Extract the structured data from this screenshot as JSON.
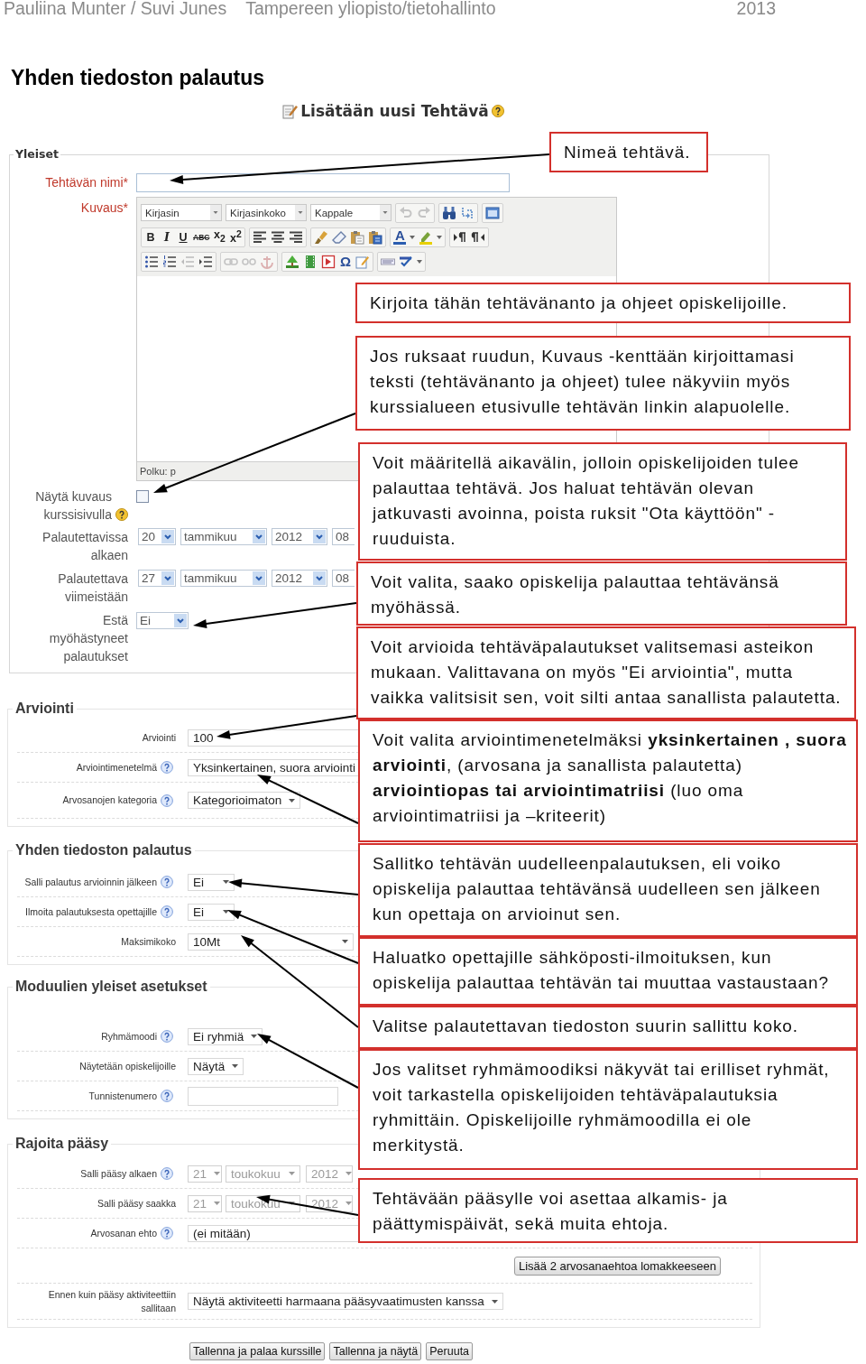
{
  "header": {
    "authors": "Pauliina Munter / Suvi Junes",
    "organization": "Tampereen yliopisto/tietohallinto",
    "year": "2013"
  },
  "heading": "Yhden tiedoston palautus",
  "form": {
    "title": "Lisätään uusi Tehtävä",
    "general": {
      "legend": "Yleiset",
      "rows": [
        {
          "kind": "text-input",
          "label": "Tehtävän nimi*",
          "required": true,
          "help": false
        },
        {
          "kind": "editor",
          "label": "Kuvaus*",
          "required": true,
          "help": false,
          "selects": [
            "Kirjasin",
            "Kirjasinkoko",
            "Kappale"
          ],
          "buttons": [
            "B",
            "I",
            "U",
            "ABC",
            "x$_{2}$",
            "x$^{2}$",
            "A",
            "Ω"
          ],
          "path": "Polku: p"
        },
        {
          "kind": "checkbox",
          "label": "Näytä kuvaus kurssisivulla",
          "required": false,
          "help": true,
          "checked": false
        },
        {
          "kind": "date",
          "label": "Palautettavissa alkaen",
          "required": false,
          "help": false,
          "parts": [
            "20",
            "tammikuu",
            "2012",
            "08"
          ]
        },
        {
          "kind": "date",
          "label": "Palautettava viimeistään",
          "required": false,
          "help": false,
          "parts": [
            "27",
            "tammikuu",
            "2012",
            "08"
          ]
        },
        {
          "kind": "select",
          "label": "Estä myöhästyneet palautukset",
          "required": false,
          "help": false,
          "value": "Ei"
        }
      ]
    },
    "sections": [
      {
        "legend": "Arviointi",
        "rows": [
          {
            "kind": "long-field",
            "label": "Arviointi",
            "help": false,
            "value": "100"
          },
          {
            "kind": "long-field",
            "label": "Arviointimenetelmä",
            "help": true,
            "value": "Yksinkertainen, suora arviointi"
          },
          {
            "kind": "select",
            "label": "Arvosanojen kategoria",
            "help": true,
            "value": "Kategorioimaton"
          }
        ]
      },
      {
        "legend": "Yhden tiedoston palautus",
        "rows": [
          {
            "kind": "select",
            "label": "Salli palautus arvioinnin jälkeen",
            "help": true,
            "value": "Ei"
          },
          {
            "kind": "select",
            "label": "Ilmoita palautuksesta opettajille",
            "help": true,
            "value": "Ei"
          },
          {
            "kind": "long-select",
            "label": "Maksimikoko",
            "help": false,
            "value": "10Mt"
          }
        ]
      },
      {
        "legend": "Moduulien yleiset asetukset",
        "rows": [
          {
            "kind": "select",
            "label": "Ryhmämoodi",
            "help": true,
            "value": "Ei ryhmiä"
          },
          {
            "kind": "select",
            "label": "Näytetään opiskelijoille",
            "help": false,
            "value": "Näytä"
          },
          {
            "kind": "input",
            "label": "Tunnistenumero",
            "help": true
          }
        ]
      },
      {
        "legend": "Rajoita pääsy",
        "rows": [
          {
            "kind": "date",
            "label": "Salli pääsy alkaen",
            "help": true,
            "disabled": true,
            "parts": [
              "21",
              "toukokuu",
              "2012"
            ]
          },
          {
            "kind": "date",
            "label": "Salli pääsy saakka",
            "help": false,
            "disabled": true,
            "parts": [
              "21",
              "toukokuu",
              "2012"
            ]
          },
          {
            "kind": "long-field",
            "label": "Arvosanan ehto",
            "help": true,
            "disabled": false,
            "value": "(ei mitään)"
          },
          {
            "kind": "button",
            "disabled": false,
            "value": "Lisää 2 arvosanaehtoa lomakkeeseen"
          },
          {
            "kind": "select",
            "label": "Ennen kuin pääsy aktiviteettiin sallitaan",
            "help": false,
            "disabled": false,
            "value": "Näytä aktiviteetti harmaana pääsyvaatimusten kanssa"
          }
        ]
      }
    ],
    "buttons": [
      "Tallenna ja palaa kurssille",
      "Tallenna ja näytä",
      "Peruuta"
    ]
  },
  "callouts": [
    {
      "text": "Nimeä tehtävä.",
      "arrow": true
    },
    {
      "text": "Kirjoita tähän tehtävänanto ja ohjeet opiskelijoille.",
      "arrow": false
    },
    {
      "text": "Jos ruksaat ruudun, Kuvaus -kenttään kirjoittamasi teksti (tehtävänanto ja ohjeet) tulee näkyviin myös kurssialueen etusivulle tehtävän linkin alapuolelle.",
      "arrow": true
    },
    {
      "text": "Voit määritellä aikavälin, jolloin opiskelijoiden tulee palauttaa tehtävä. Jos haluat tehtävän olevan jatkuvasti avoinna, poista ruksit \"Ota käyttöön\" - ruuduista.",
      "arrow": false
    },
    {
      "text": "Voit valita, saako opiskelija palauttaa tehtävänsä myöhässä.",
      "arrow": true
    },
    {
      "text": "Voit arvioida tehtäväpalautukset valitsemasi asteikon mukaan. Valittavana on myös \"Ei arviointia\", mutta vaikka valitsisit sen, voit silti antaa sanallista palautetta.",
      "arrow": true
    },
    {
      "text": "Voit valita arviointimenetelmäksi **yksinkertainen , suora arviointi**, (arvosana ja sanallista palautetta) **arviointiopas tai arviointimatriisi** (luo oma arviointimatriisi ja –kriteerit)",
      "arrow": true
    },
    {
      "text": "Sallitko tehtävän uudelleenpalautuksen, eli voiko opiskelija palauttaa tehtävänsä uudelleen sen jälkeen kun opettaja on arvioinut sen.",
      "arrow": true
    },
    {
      "text": "Haluatko opettajille sähköposti-ilmoituksen, kun opiskelija palauttaa tehtävän tai muuttaa vastaustaan?",
      "arrow": true
    },
    {
      "text": "Valitse palautettavan tiedoston suurin sallittu koko.",
      "arrow": true
    },
    {
      "text": "Jos valitset ryhmämoodiksi näkyvät tai erilliset ryhmät, voit tarkastella opiskelijoiden tehtäväpalautuksia ryhmittäin. Opiskelijoille ryhmämoodilla ei ole merkitystä.",
      "arrow": true
    },
    {
      "text": "Tehtävään pääsylle voi asettaa alkamis- ja päättymispäivät, sekä muita ehtoja.",
      "arrow": true
    }
  ]
}
